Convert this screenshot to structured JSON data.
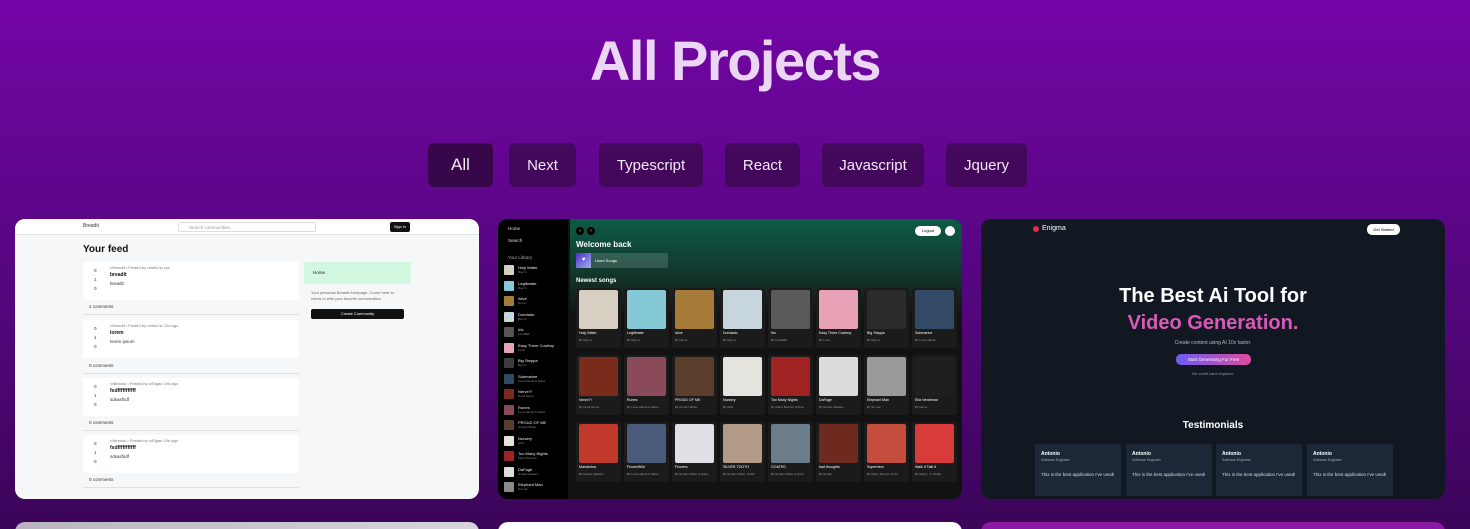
{
  "page": {
    "title": "All Projects"
  },
  "filters": [
    {
      "label": "All",
      "active": true
    },
    {
      "label": "Next"
    },
    {
      "label": "Typescript"
    },
    {
      "label": "React"
    },
    {
      "label": "Javascript"
    },
    {
      "label": "Jquery"
    }
  ],
  "projects": [
    {
      "name": "breadit-feed",
      "header": {
        "logo": "Breadit",
        "search_placeholder": "Search communities...",
        "signin": "Sign in"
      },
      "feed_title": "Your feed",
      "posts": [
        {
          "meta": "r/breadit • Posted by u/ahs-hu xyz",
          "title": "breadit",
          "body": "breadit",
          "votes": [
            "0",
            "1",
            "0"
          ],
          "comments": "2 comments"
        },
        {
          "meta": "r/breadit • Posted by u/ahs-hu 12d ago",
          "title": "lorem",
          "body": "lorem ipsum",
          "votes": [
            "0",
            "1",
            "0"
          ],
          "comments": "0 comments"
        },
        {
          "meta": "r/dilmook • Posted by u/Elgau 19d ago",
          "title": "fsdfffffffffff",
          "body": "sdsasfsdf",
          "votes": [
            "0",
            "1",
            "0"
          ],
          "comments": "0 comments"
        },
        {
          "meta": "r/dilmook • Posted by u/Elgau 19d ago",
          "title": "fsdfffffffffff",
          "body": "sdsasfsdf",
          "votes": [
            "0",
            "1",
            "0"
          ],
          "comments": "0 comments"
        }
      ],
      "sidebar": {
        "home": "Home",
        "text": "Your personal Breadit frontpage. Come here to check in with your favorite communities.",
        "button": "Create Community"
      }
    },
    {
      "name": "spotify-clone",
      "sidebar": {
        "home": "Home",
        "search": "Search",
        "library": "Your Library"
      },
      "library": [
        {
          "name": "Holy Water",
          "sub": "Ray G",
          "color": "#d6cfc2"
        },
        {
          "name": "Legitimate",
          "sub": "Ray G",
          "color": "#86c9d6"
        },
        {
          "name": "Alive",
          "sub": "Nemo",
          "color": "#a77b3a"
        },
        {
          "name": "Dondado",
          "sub": "Ray G",
          "color": "#c7d5dc"
        },
        {
          "name": "Iris",
          "sub": "LoreREF",
          "color": "#555"
        },
        {
          "name": "Easy There Cowboy",
          "sub": "Luca",
          "color": "#e8a2b5"
        },
        {
          "name": "Big Steppa",
          "sub": "Ray G",
          "color": "#3d3d3d"
        },
        {
          "name": "Submarine",
          "sub": "Luca Hands & Salve",
          "color": "#334a66"
        },
        {
          "name": "Nerve?!",
          "sub": "Dyna Nemo",
          "color": "#7a2b1c"
        },
        {
          "name": "Runes",
          "sub": "Luca Hands & Salve",
          "color": "#8b4a5a"
        },
        {
          "name": "PROUD OF ME",
          "sub": "Armani White",
          "color": "#5b3f2c"
        },
        {
          "name": "Nursery",
          "sub": "Acid",
          "color": "#e5e3de"
        },
        {
          "name": "Too Many Nights",
          "sub": "Metro Boomin",
          "color": "#a12222"
        },
        {
          "name": "DaFage",
          "sub": "Dudes Kaldaon",
          "color": "#dcdcdc"
        },
        {
          "name": "Elephant Man",
          "sub": "Su Luk",
          "color": "#8a8a8a"
        }
      ],
      "welcome": "Welcome back",
      "liked_songs": "Liked Songs",
      "newest_label": "Newest songs",
      "logout": "Logout",
      "songs": [
        {
          "name": "Holy Water",
          "artist": "By Ray G",
          "color": "#d6cfc2"
        },
        {
          "name": "Legitimate",
          "artist": "By Ray G",
          "color": "#86c9d6"
        },
        {
          "name": "Alive",
          "artist": "By Nemo",
          "color": "#a77b3a"
        },
        {
          "name": "Dondado",
          "artist": "By Ray G",
          "color": "#c7d5dc"
        },
        {
          "name": "Iris",
          "artist": "By LoreREF",
          "color": "#5a5a5a"
        },
        {
          "name": "Easy There Cowboy",
          "artist": "By Luca",
          "color": "#e8a2b5"
        },
        {
          "name": "Big Steppa",
          "artist": "By Ray G",
          "color": "#2c2c2c"
        },
        {
          "name": "Submarine",
          "artist": "By Luca Hands",
          "color": "#334a66"
        },
        {
          "name": "Nerve?!",
          "artist": "By Dyna Nemo",
          "color": "#7a2b1c"
        },
        {
          "name": "Runes",
          "artist": "By Luca Hands & Salve",
          "color": "#8b4a5a"
        },
        {
          "name": "PROUD OF ME",
          "artist": "By Armani White",
          "color": "#5b3f2c"
        },
        {
          "name": "Nursery",
          "artist": "By Acid",
          "color": "#e5e3de"
        },
        {
          "name": "Too Many Nights",
          "artist": "By Metro Boomin Chyna",
          "color": "#a12222"
        },
        {
          "name": "DaFage",
          "artist": "By Dudes Kaldaon",
          "color": "#dcdcdc"
        },
        {
          "name": "Elephant Man",
          "artist": "By Su Luk",
          "color": "#9a9a9a"
        },
        {
          "name": "Ella Vendeivar",
          "artist": "By Nemo",
          "color": "#1f1f1f"
        },
        {
          "name": "Manderina",
          "artist": "By Dudes Kaldaon",
          "color": "#c0392b"
        },
        {
          "name": "FlowerWild",
          "artist": "By Luca Hands & Salve",
          "color": "#4a5a7a"
        },
        {
          "name": "Flowers",
          "artist": "By Armani White & Salve",
          "color": "#e0dfe5"
        },
        {
          "name": "SILVER TOOTH",
          "artist": "By Armani White, ASAP",
          "color": "#b39a86"
        },
        {
          "name": "GOATED",
          "artist": "By Armani White & Dyna",
          "color": "#6b7d8a"
        },
        {
          "name": "bad thoughts",
          "artist": "By Armali",
          "color": "#6e2a1f"
        },
        {
          "name": "Superhero",
          "artist": "By Metro Boomin & Fut",
          "color": "#c44d3d"
        },
        {
          "name": "Walk It Talk It",
          "artist": "By Migos , ft. Drake",
          "color": "#d93b3b"
        }
      ]
    },
    {
      "name": "enigma-ai",
      "brand": "Enigma",
      "get_started": "Get Started",
      "headline_1": "The Best Ai Tool for",
      "headline_2": "Video Generation.",
      "subtitle": "Create content using AI 10x faster.",
      "cta": "Start Generating For Free",
      "note": "No credit card required.",
      "testimonials_title": "Testimonials",
      "testimonials": [
        {
          "name": "Antonio",
          "role": "Software Engineer",
          "text": "This is the best application I've used!"
        },
        {
          "name": "Antonio",
          "role": "Software Engineer",
          "text": "This is the best application I've used!"
        },
        {
          "name": "Antonio",
          "role": "Software Engineer",
          "text": "This is the best application I've used!"
        },
        {
          "name": "Antonio",
          "role": "Software Engineer",
          "text": "This is the best application I've used!"
        }
      ]
    }
  ],
  "colors": {
    "background_top": "#7405a6",
    "title": "#ecd6f6",
    "filter_bg": "#3a0a4a",
    "accent_pink": "#d85ab8"
  }
}
